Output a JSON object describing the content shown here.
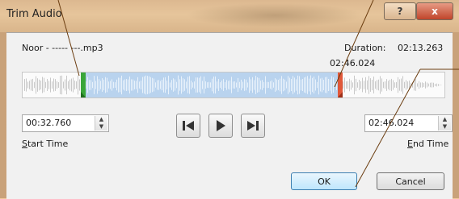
{
  "window": {
    "title": "Trim Audio"
  },
  "titlebar": {
    "help_label": "?",
    "close_label": "x"
  },
  "file": {
    "name": "Noor - ----- ---.mp3"
  },
  "duration": {
    "label": "Duration:",
    "value": "02:13.263"
  },
  "selection_end_time": "02:46.024",
  "start_time": {
    "value": "00:32.760",
    "label": "Start Time"
  },
  "end_time": {
    "value": "02:46.024",
    "label": "End Time"
  },
  "buttons": {
    "ok": "OK",
    "cancel": "Cancel"
  },
  "icons": {
    "help": "question-icon",
    "close": "close-icon",
    "previous": "previous-frame-icon",
    "play": "play-icon",
    "next": "next-frame-icon"
  },
  "colors": {
    "start_marker": "#3aa63a",
    "end_marker": "#e0583a",
    "selection": "#b9d3ee",
    "leader_line": "#6b3d10"
  }
}
